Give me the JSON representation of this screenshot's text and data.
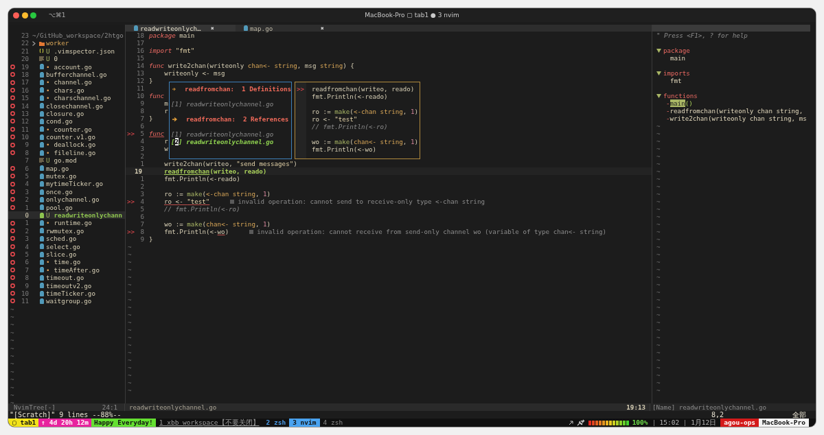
{
  "window": {
    "title": "MacBook-Pro ▢ tab1 ● 3 nvim",
    "shortcut": "⌥⌘1"
  },
  "tree": {
    "items": [
      {
        "num": "23",
        "kind": "path",
        "name": "~/GitHub_workspace/2htgo",
        "error": false,
        "selected": false
      },
      {
        "num": "22",
        "kind": "folder",
        "name": "worker",
        "expanded": false,
        "error": false,
        "selected": false
      },
      {
        "num": "21",
        "kind": "json",
        "git": "U",
        "name": ".vimspector.json",
        "error": false,
        "selected": false
      },
      {
        "num": "20",
        "kind": "text",
        "git": "U",
        "name": "0",
        "error": false,
        "selected": false
      },
      {
        "num": "19",
        "kind": "go",
        "git": "•",
        "name": "account.go",
        "error": true,
        "selected": false
      },
      {
        "num": "18",
        "kind": "go",
        "name": "bufferchannel.go",
        "error": true,
        "selected": false
      },
      {
        "num": "17",
        "kind": "go",
        "git": "•",
        "name": "channel.go",
        "error": true,
        "selected": false
      },
      {
        "num": "16",
        "kind": "go",
        "git": "•",
        "name": "chars.go",
        "error": true,
        "selected": false
      },
      {
        "num": "15",
        "kind": "go",
        "git": "•",
        "name": "charschannel.go",
        "error": true,
        "selected": false
      },
      {
        "num": "14",
        "kind": "go",
        "name": "closechannel.go",
        "error": true,
        "selected": false
      },
      {
        "num": "13",
        "kind": "go",
        "name": "closure.go",
        "error": true,
        "selected": false
      },
      {
        "num": "12",
        "kind": "go",
        "name": "cond.go",
        "error": true,
        "selected": false
      },
      {
        "num": "11",
        "kind": "go",
        "git": "•",
        "name": "counter.go",
        "error": true,
        "selected": false
      },
      {
        "num": "10",
        "kind": "go",
        "name": "counter.v1.go",
        "error": true,
        "selected": false
      },
      {
        "num": "9",
        "kind": "go",
        "git": "•",
        "name": "deallock.go",
        "error": true,
        "selected": false
      },
      {
        "num": "8",
        "kind": "go",
        "git": "•",
        "name": "fileline.go",
        "error": true,
        "selected": false
      },
      {
        "num": "7",
        "kind": "text",
        "git": "U",
        "name": "go.mod",
        "error": false,
        "selected": false
      },
      {
        "num": "6",
        "kind": "go",
        "name": "map.go",
        "error": true,
        "selected": false
      },
      {
        "num": "5",
        "kind": "go",
        "name": "mutex.go",
        "error": true,
        "selected": false
      },
      {
        "num": "4",
        "kind": "go",
        "name": "mytimeTicker.go",
        "error": true,
        "selected": false
      },
      {
        "num": "3",
        "kind": "go",
        "name": "once.go",
        "error": true,
        "selected": false
      },
      {
        "num": "2",
        "kind": "go",
        "name": "onlychannel.go",
        "error": true,
        "selected": false
      },
      {
        "num": "1",
        "kind": "go",
        "name": "pool.go",
        "error": true,
        "selected": false
      },
      {
        "num": "0",
        "kind": "go",
        "git": "U",
        "name": "readwriteonlychann",
        "error": false,
        "selected": true
      },
      {
        "num": "1",
        "kind": "go",
        "git": "•",
        "name": "runtime.go",
        "error": true,
        "selected": false
      },
      {
        "num": "2",
        "kind": "go",
        "name": "rwmutex.go",
        "error": true,
        "selected": false
      },
      {
        "num": "3",
        "kind": "go",
        "name": "sched.go",
        "error": true,
        "selected": false
      },
      {
        "num": "4",
        "kind": "go",
        "name": "select.go",
        "error": true,
        "selected": false
      },
      {
        "num": "5",
        "kind": "go",
        "name": "slice.go",
        "error": true,
        "selected": false
      },
      {
        "num": "6",
        "kind": "go",
        "git": "•",
        "name": "time.go",
        "error": true,
        "selected": false
      },
      {
        "num": "7",
        "kind": "go",
        "git": "•",
        "name": "timeAfter.go",
        "error": true,
        "selected": false
      },
      {
        "num": "8",
        "kind": "go",
        "name": "timeout.go",
        "error": true,
        "selected": false
      },
      {
        "num": "9",
        "kind": "go",
        "name": "timeoutv2.go",
        "error": true,
        "selected": false
      },
      {
        "num": "10",
        "kind": "go",
        "name": "timeTicker.go",
        "error": true,
        "selected": false
      },
      {
        "num": "11",
        "kind": "go",
        "name": "waitgroup.go",
        "error": true,
        "selected": false
      }
    ],
    "filler": [
      "~",
      "~",
      "~",
      "~",
      "~",
      "~",
      "~",
      "~",
      "~",
      "~",
      "~",
      "~",
      "~"
    ]
  },
  "editor": {
    "tabs": [
      {
        "label": "readwriteonlych…",
        "close": "✖",
        "selected": true
      },
      {
        "label": "map.go",
        "close": "✖",
        "selected": false
      }
    ],
    "lines": [
      {
        "num": "18",
        "current": false,
        "tokens": [
          {
            "text": "package",
            "kind": "kw"
          },
          {
            "text": " main",
            "kind": "plain"
          }
        ]
      },
      {
        "num": "17",
        "current": false
      },
      {
        "num": "16",
        "current": false,
        "tokens": [
          {
            "text": "import",
            "kind": "kw"
          },
          {
            "text": " \"fmt\"",
            "kind": "str"
          }
        ]
      },
      {
        "num": "15",
        "current": false
      },
      {
        "num": "14",
        "current": false,
        "tokens": [
          {
            "text": "func",
            "kind": "kw"
          },
          {
            "text": " write2chan(writeonly ",
            "kind": "plain"
          },
          {
            "text": "chan<- string",
            "kind": "type"
          },
          {
            "text": ", msg ",
            "kind": "plain"
          },
          {
            "text": "string",
            "kind": "type"
          },
          {
            "text": ") {",
            "kind": "plain"
          }
        ]
      },
      {
        "num": "13",
        "current": false,
        "tokens": [
          {
            "text": "    writeonly <- msg",
            "kind": "plain"
          }
        ]
      },
      {
        "num": "12",
        "current": false,
        "tokens": [
          {
            "text": "}",
            "kind": "plain"
          }
        ]
      },
      {
        "num": "11",
        "current": false
      },
      {
        "num": "10",
        "current": false,
        "tokens": [
          {
            "text": "func",
            "kind": "kw"
          }
        ]
      },
      {
        "num": "9",
        "current": false,
        "tokens": [
          {
            "text": "    m",
            "kind": "plain"
          }
        ]
      },
      {
        "num": "8",
        "current": false,
        "tokens": [
          {
            "text": "    r",
            "kind": "plain"
          }
        ]
      },
      {
        "num": "7",
        "current": false,
        "tokens": [
          {
            "text": "}",
            "kind": "plain"
          }
        ]
      },
      {
        "num": "6",
        "current": false
      },
      {
        "num": "5",
        "current": false,
        "sign": ">>",
        "tokens": [
          {
            "text": "func",
            "kind": "kw",
            "underline": true
          }
        ]
      },
      {
        "num": "4",
        "current": false,
        "tokens": [
          {
            "text": "    r",
            "kind": "plain"
          }
        ]
      },
      {
        "num": "3",
        "current": false,
        "tokens": [
          {
            "text": "    w",
            "kind": "plain"
          }
        ]
      },
      {
        "num": "2",
        "current": false
      },
      {
        "num": "1",
        "current": false,
        "tokens": [
          {
            "text": "    write2chan(writeo, ",
            "kind": "plain"
          },
          {
            "text": "\"send messages\"",
            "kind": "str"
          },
          {
            "text": ")",
            "kind": "plain"
          }
        ]
      },
      {
        "num": "19",
        "current": true,
        "indent": true,
        "tokens": [
          {
            "text": "readfromchan",
            "kind": "hl",
            "underline": true
          },
          {
            "text": "(writeo, reado)",
            "kind": "hl"
          }
        ]
      },
      {
        "num": "1",
        "current": false,
        "tokens": [
          {
            "text": "    fmt.Println(<-reado)",
            "kind": "plain"
          }
        ]
      },
      {
        "num": "2",
        "current": false
      },
      {
        "num": "3",
        "current": false,
        "tokens": [
          {
            "text": "    ro := ",
            "kind": "plain"
          },
          {
            "text": "make",
            "kind": "call"
          },
          {
            "text": "(",
            "kind": "plain"
          },
          {
            "text": "<-chan string",
            "kind": "type"
          },
          {
            "text": ", ",
            "kind": "plain"
          },
          {
            "text": "1",
            "kind": "num"
          },
          {
            "text": ")",
            "kind": "plain"
          }
        ]
      },
      {
        "num": "4",
        "current": false,
        "sign": ">>",
        "indent": true,
        "tokens": [
          {
            "text": "ro <- ",
            "kind": "plain",
            "underline": true
          },
          {
            "text": "\"test\"",
            "kind": "str",
            "underline": true
          }
        ],
        "diagnostic": "invalid operation: cannot send to receive-only type <-chan string"
      },
      {
        "num": "5",
        "current": false,
        "indent": true,
        "tokens": [
          {
            "text": "// fmt.Println(<-ro)",
            "kind": "comment"
          }
        ]
      },
      {
        "num": "6",
        "current": false
      },
      {
        "num": "7",
        "current": false,
        "tokens": [
          {
            "text": "    wo := ",
            "kind": "plain"
          },
          {
            "text": "make",
            "kind": "call"
          },
          {
            "text": "(",
            "kind": "plain"
          },
          {
            "text": "chan<- string",
            "kind": "type"
          },
          {
            "text": ", ",
            "kind": "plain"
          },
          {
            "text": "1",
            "kind": "num"
          },
          {
            "text": ")",
            "kind": "plain"
          }
        ]
      },
      {
        "num": "8",
        "current": false,
        "sign": ">>",
        "tokens": [
          {
            "text": "    fmt.Println(<-",
            "kind": "plain"
          },
          {
            "text": "wo",
            "kind": "plain",
            "underline": true
          },
          {
            "text": ")",
            "kind": "plain"
          }
        ],
        "diagnostic": "invalid operation: cannot receive from send-only channel wo (variable of type chan<- string)"
      },
      {
        "num": "9",
        "current": false,
        "tokens": [
          {
            "text": "}",
            "kind": "plain"
          }
        ]
      }
    ],
    "definitions": {
      "lines": [
        {
          "kind": "header",
          "name": "readfromchan:",
          "count": "1",
          "label": "Definitions"
        },
        {
          "kind": "blank"
        },
        {
          "kind": "file",
          "index": "[1]",
          "name": "readwriteonlychannel.go",
          "selected": false
        },
        {
          "kind": "blank"
        },
        {
          "kind": "header",
          "name": "readfromchan:",
          "count": "2",
          "label": "References"
        },
        {
          "kind": "blank"
        },
        {
          "kind": "file",
          "index": "[1]",
          "name": "readwriteonlychannel.go",
          "selected": false
        },
        {
          "kind": "file",
          "index": "[2]",
          "name": "readwriteonlychannel.go",
          "selected": true
        }
      ]
    },
    "preview": {
      "lines": [
        {
          "kind": "code",
          "sign": ">>",
          "tokens": [
            {
              "text": "readfromchan(writeo, reado)",
              "kind": "plain"
            }
          ]
        },
        {
          "kind": "code",
          "tokens": [
            {
              "text": "fmt.Println(<-reado)",
              "kind": "plain"
            }
          ]
        },
        {
          "kind": "blank"
        },
        {
          "kind": "code",
          "tokens": [
            {
              "text": "ro := ",
              "kind": "plain"
            },
            {
              "text": "make",
              "kind": "call"
            },
            {
              "text": "(",
              "kind": "plain"
            },
            {
              "text": "<-chan string",
              "kind": "type"
            },
            {
              "text": ", ",
              "kind": "plain"
            },
            {
              "text": "1",
              "kind": "num"
            },
            {
              "text": ")",
              "kind": "plain"
            }
          ]
        },
        {
          "kind": "code",
          "tokens": [
            {
              "text": "ro <- ",
              "kind": "plain"
            },
            {
              "text": "\"test\"",
              "kind": "str"
            }
          ]
        },
        {
          "kind": "code",
          "tokens": [
            {
              "text": "// fmt.Println(<-ro)",
              "kind": "comment"
            }
          ]
        },
        {
          "kind": "blank"
        },
        {
          "kind": "code",
          "tokens": [
            {
              "text": "wo := ",
              "kind": "plain"
            },
            {
              "text": "make",
              "kind": "call"
            },
            {
              "text": "(",
              "kind": "plain"
            },
            {
              "text": "chan<- string",
              "kind": "type"
            },
            {
              "text": ", ",
              "kind": "plain"
            },
            {
              "text": "1",
              "kind": "num"
            },
            {
              "text": ")",
              "kind": "plain"
            }
          ]
        },
        {
          "kind": "code",
          "tokens": [
            {
              "text": "fmt.Println(<-wo)",
              "kind": "plain"
            }
          ]
        }
      ]
    },
    "filler": [
      "~",
      "~",
      "~",
      "~",
      "~",
      "~",
      "~",
      "~",
      "~",
      "~",
      "~",
      "~",
      "~",
      "~",
      "~",
      "~",
      "~",
      "~",
      "~",
      "~"
    ]
  },
  "tagbar": {
    "help": "\" Press <F1>, ? for help",
    "groups": [
      {
        "label": "package",
        "expanded": true,
        "items": [
          {
            "name": "main",
            "selected": false
          }
        ]
      },
      {
        "label": "imports",
        "expanded": true,
        "items": [
          {
            "name": "fmt",
            "selected": false
          }
        ]
      },
      {
        "label": "functions",
        "expanded": true,
        "items": [
          {
            "prefix": "-",
            "name": "main",
            "suffix": "()",
            "selected": true
          },
          {
            "prefix": "-",
            "name": "readfromchan",
            "suffix": "(writeonly chan string,",
            "selected": false
          },
          {
            "prefix": "-",
            "name": "write2chan",
            "suffix": "(writeonly chan string, ms",
            "selected": false
          }
        ]
      }
    ],
    "filler": [
      "~",
      "~",
      "~",
      "~",
      "~",
      "~",
      "~",
      "~",
      "~",
      "~",
      "~",
      "~",
      "~",
      "~",
      "~",
      "~",
      "~",
      "~",
      "~",
      "~",
      "~",
      "~",
      "~",
      "~",
      "~",
      "~",
      "~",
      "~",
      "~",
      "~",
      "~",
      "~",
      "~",
      "~",
      "~",
      "~"
    ]
  },
  "statusline": {
    "tree_name": "NvimTree[-]",
    "tree_pos": "24:1",
    "file": "readwriteonlychannel.go",
    "pos": "19:13",
    "tagbar": "[Name] readwriteonlychannel.go"
  },
  "cmdline": {
    "message": "\"[Scratch]\" 9 lines --88%--",
    "ruler": "8,2",
    "scroll": "全部"
  },
  "tmux": {
    "left": [
      {
        "text": "▢ tab1",
        "kind": "session"
      },
      {
        "text": "↑ 4d 20h 12m",
        "kind": "uptime"
      },
      {
        "text": "Happy Everyday!",
        "kind": "motto"
      }
    ],
    "windows": [
      {
        "text": "1 xbb_workspace【不要关闭】",
        "kind": "marked",
        "selected": false
      },
      {
        "text": "2 zsh",
        "kind": "last",
        "selected": false
      },
      {
        "text": "3 nvim",
        "kind": "normal",
        "selected": true
      },
      {
        "text": "4 zsh",
        "kind": "normal",
        "selected": false
      }
    ],
    "battery": {
      "level": 1,
      "reading": "100%"
    },
    "time": "15:02",
    "date": "1月12日",
    "user": "agou-ops",
    "host": "MacBook-Pro"
  }
}
